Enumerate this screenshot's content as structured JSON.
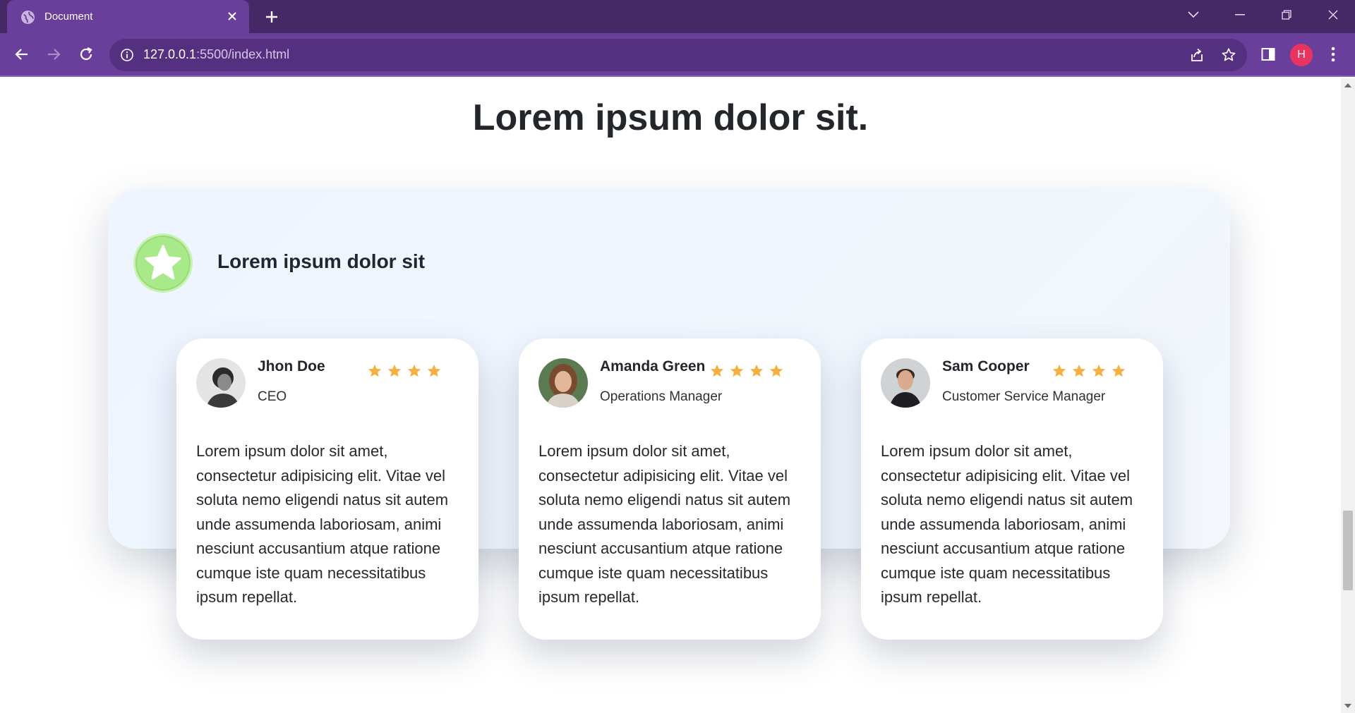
{
  "browser": {
    "tab_title": "Document",
    "url_host": "127.0.0.1",
    "url_rest": ":5500/index.html",
    "profile_initial": "H"
  },
  "colors": {
    "chrome_dark": "#452865",
    "chrome_tab": "#6a3e9b",
    "omnibox": "#553080",
    "star": "#f5b041",
    "badge": "#a8ea8a",
    "profile": "#e8345f"
  },
  "page": {
    "heading": "Lorem ipsum dolor sit.",
    "section_title": "Lorem ipsum dolor sit",
    "section_icon": "star-badge-icon",
    "testimonials": [
      {
        "name": "Jhon Doe",
        "role": "CEO",
        "rating": 4,
        "text": "Lorem ipsum dolor sit amet, consectetur adipisicing elit. Vitae vel soluta nemo eligendi natus sit autem unde assumenda laboriosam, animi nesciunt accusantium atque ratione cumque iste quam necessitatibus ipsum repellat."
      },
      {
        "name": "Amanda Green",
        "role": "Operations Manager",
        "rating": 4,
        "text": "Lorem ipsum dolor sit amet, consectetur adipisicing elit. Vitae vel soluta nemo eligendi natus sit autem unde assumenda laboriosam, animi nesciunt accusantium atque ratione cumque iste quam necessitatibus ipsum repellat."
      },
      {
        "name": "Sam Cooper",
        "role": "Customer Service Manager",
        "rating": 4,
        "text": "Lorem ipsum dolor sit amet, consectetur adipisicing elit. Vitae vel soluta nemo eligendi natus sit autem unde assumenda laboriosam, animi nesciunt accusantium atque ratione cumque iste quam necessitatibus ipsum repellat."
      }
    ]
  }
}
